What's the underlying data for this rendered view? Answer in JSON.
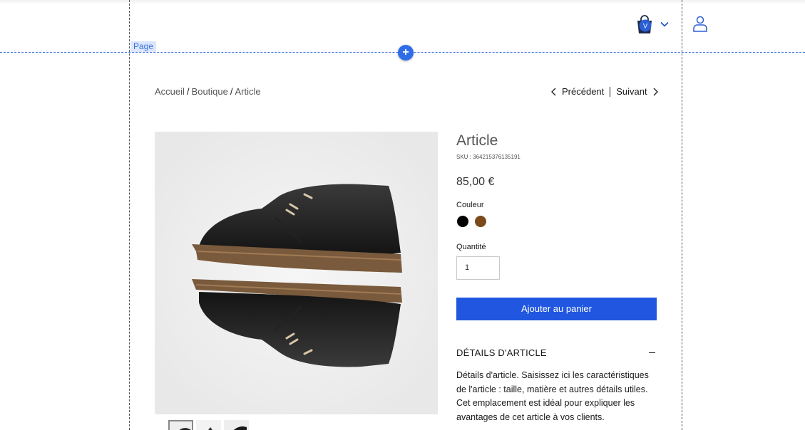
{
  "editor": {
    "page_tag": "Page",
    "add_section_symbol": "+"
  },
  "header": {
    "cart_badge": "V",
    "icons": [
      "shopping-bag-icon",
      "chevron-down-icon",
      "user-icon"
    ]
  },
  "breadcrumb": {
    "items": [
      "Accueil",
      "Boutique",
      "Article"
    ],
    "separator": "/"
  },
  "pager": {
    "previous_label": "Précédent",
    "next_label": "Suivant"
  },
  "product": {
    "title": "Article",
    "sku": "SKU : 364215376135191",
    "price": "85,00 €",
    "color_label": "Couleur",
    "colors": [
      {
        "name": "black",
        "hex": "#000000"
      },
      {
        "name": "brown",
        "hex": "#7a4a1d"
      }
    ],
    "quantity_label": "Quantité",
    "quantity_value": "1",
    "add_to_cart_label": "Ajouter au panier",
    "details_title": "DÉTAILS D'ARTICLE",
    "details_text": "Détails d'article. Saisissez ici les caractéristiques de l'article : taille, matière et autres détails utiles. Cet emplacement est idéal pour expliquer les avantages de cet article à vos clients."
  },
  "colors": {
    "accent": "#2056e0",
    "guide": "#3b6fe0"
  }
}
